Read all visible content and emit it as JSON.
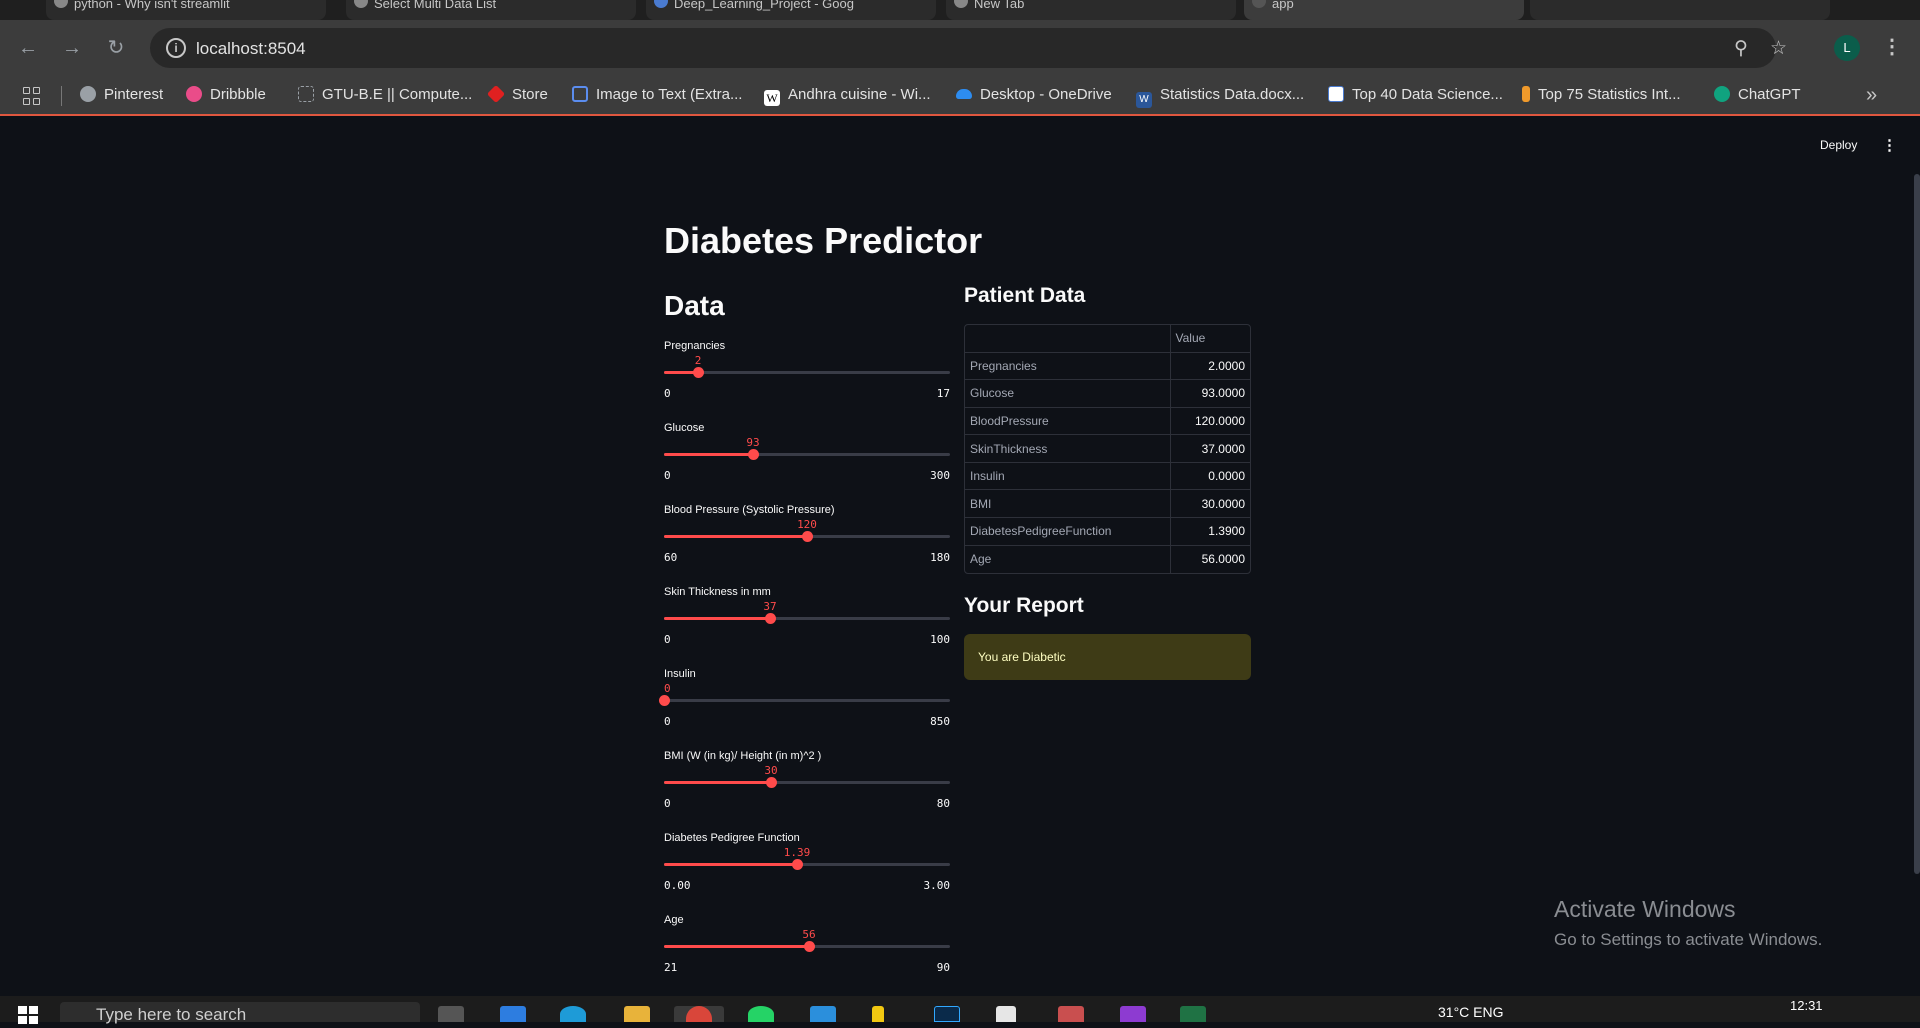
{
  "browser": {
    "tabs": [
      {
        "label": "python - Why isn't streamlit",
        "active": false
      },
      {
        "label": "Select Multi Data List",
        "active": false
      },
      {
        "label": "Deep_Learning_Project - Goog",
        "active": false
      },
      {
        "label": "New Tab",
        "active": false
      },
      {
        "label": "app",
        "active": true
      },
      {
        "label": "",
        "active": false
      }
    ],
    "url": "localhost:8504",
    "profile_initial": "L",
    "bookmarks": [
      {
        "label": "Pinterest",
        "icon": "pinterest-icon",
        "color": "#9aa0a6"
      },
      {
        "label": "Dribbble",
        "icon": "dribbble-icon",
        "color": "#ea4c89"
      },
      {
        "label": "GTU-B.E || Compute...",
        "icon": "page-icon",
        "color": "#5f6368"
      },
      {
        "label": "Store",
        "icon": "store-icon",
        "color": "#e02020"
      },
      {
        "label": "Image to Text (Extra...",
        "icon": "image-text-icon",
        "color": "#5b8def"
      },
      {
        "label": "Andhra cuisine - Wi...",
        "icon": "wikipedia-icon",
        "color": "#ffffff"
      },
      {
        "label": "Desktop - OneDrive",
        "icon": "onedrive-icon",
        "color": "#2d8cf0"
      },
      {
        "label": "Statistics Data.docx...",
        "icon": "word-icon",
        "color": "#2b579a"
      },
      {
        "label": "Top 40 Data Science...",
        "icon": "chart-icon",
        "color": "#4a7bd0"
      },
      {
        "label": "Top 75 Statistics Int...",
        "icon": "runner-icon",
        "color": "#f09a2b"
      },
      {
        "label": "ChatGPT",
        "icon": "chatgpt-icon",
        "color": "#10a37f"
      }
    ]
  },
  "app": {
    "deploy_label": "Deploy",
    "title": "Diabetes Predictor",
    "data_header": "Data",
    "sliders": [
      {
        "label": "Pregnancies",
        "value": "2",
        "min": "0",
        "max": "17",
        "fraction": 0.1176
      },
      {
        "label": "Glucose",
        "value": "93",
        "min": "0",
        "max": "300",
        "fraction": 0.31
      },
      {
        "label": "Blood Pressure (Systolic Pressure)",
        "value": "120",
        "min": "60",
        "max": "180",
        "fraction": 0.5
      },
      {
        "label": "Skin Thickness in mm",
        "value": "37",
        "min": "0",
        "max": "100",
        "fraction": 0.37
      },
      {
        "label": "Insulin",
        "value": "0",
        "min": "0",
        "max": "850",
        "fraction": 0.0
      },
      {
        "label": "BMI (W (in kg)/ Height (in m)^2 )",
        "value": "30",
        "min": "0",
        "max": "80",
        "fraction": 0.375
      },
      {
        "label": "Diabetes Pedigree Function",
        "value": "1.39",
        "min": "0.00",
        "max": "3.00",
        "fraction": 0.4633
      },
      {
        "label": "Age",
        "value": "56",
        "min": "21",
        "max": "90",
        "fraction": 0.5072
      }
    ],
    "patient_header": "Patient Data",
    "table": {
      "value_header": "Value",
      "rows": [
        {
          "name": "Pregnancies",
          "value": "2.0000"
        },
        {
          "name": "Glucose",
          "value": "93.0000"
        },
        {
          "name": "BloodPressure",
          "value": "120.0000"
        },
        {
          "name": "SkinThickness",
          "value": "37.0000"
        },
        {
          "name": "Insulin",
          "value": "0.0000"
        },
        {
          "name": "BMI",
          "value": "30.0000"
        },
        {
          "name": "DiabetesPedigreeFunction",
          "value": "1.3900"
        },
        {
          "name": "Age",
          "value": "56.0000"
        }
      ]
    },
    "report_header": "Your Report",
    "report_result": "You are Diabetic",
    "accent_color": "#ff4b4b"
  },
  "watermark": {
    "line1": "Activate Windows",
    "line2": "Go to Settings to activate Windows."
  },
  "taskbar": {
    "search_placeholder": "Type here to search",
    "time": "12:31",
    "tray_text": "31°C  ENG"
  }
}
